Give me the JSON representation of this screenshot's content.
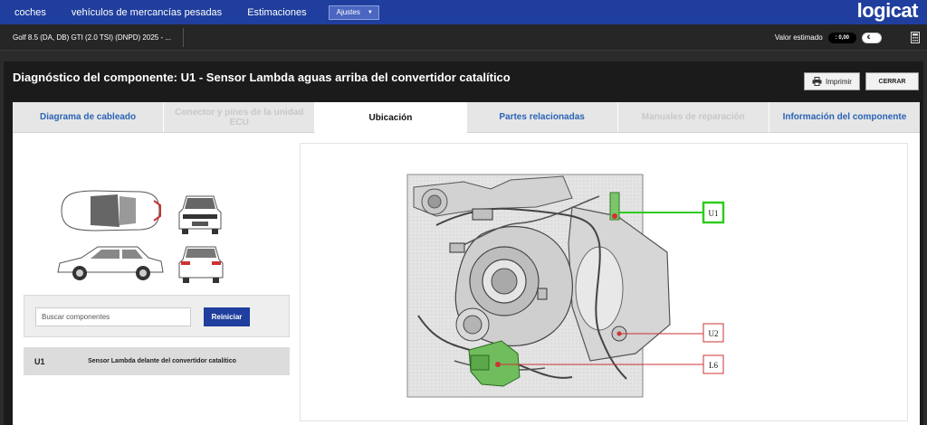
{
  "nav": {
    "items": [
      "coches",
      "vehículos de mercancías pesadas",
      "Estimaciones"
    ],
    "settings_label": "Ajustes",
    "logo": "logicat"
  },
  "subbar": {
    "vehicle": "Golf 8.5 (DA, DB) GTI (2.0 TSI) (DNPD) 2025 - ...",
    "estimate_label": "Valor estimado",
    "estimate_value": ": 0,00",
    "currency": "€"
  },
  "page": {
    "title": "Diagnóstico del componente: U1 - Sensor Lambda aguas arriba del convertidor catalítico",
    "print_label": "Imprimir",
    "close_label": "CERRAR"
  },
  "tabs": [
    {
      "label": "Diagrama de cableado",
      "state": "normal"
    },
    {
      "label": "Conector y pines de la unidad ECU",
      "state": "disabled"
    },
    {
      "label": "Ubicación",
      "state": "active"
    },
    {
      "label": "Partes relacionadas",
      "state": "normal"
    },
    {
      "label": "Manuales de reparación",
      "state": "disabled"
    },
    {
      "label": "Información del componente",
      "state": "normal"
    }
  ],
  "search": {
    "placeholder": "Buscar componentes",
    "reset_label": "Reiniciar"
  },
  "results": [
    {
      "code": "U1",
      "description": "Sensor Lambda delante del convertidor catalítico"
    }
  ],
  "diagram": {
    "labels": [
      "U1",
      "U2",
      "L6"
    ],
    "highlight_color": "#2ecc1f",
    "marker_color": "#cc3333"
  },
  "colors": {
    "nav": "#1f3e9d",
    "link": "#2a63b5"
  }
}
